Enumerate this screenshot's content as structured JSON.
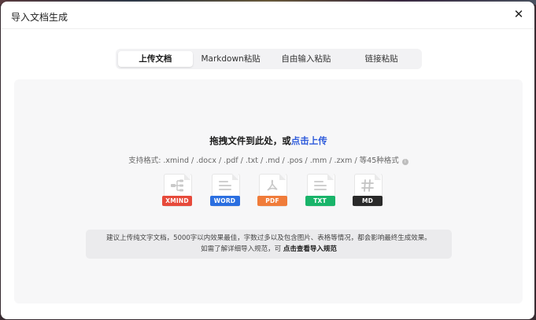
{
  "dialog": {
    "title": "导入文档生成",
    "close_glyph": "✕"
  },
  "tabs": [
    {
      "label": "上传文档",
      "active": true
    },
    {
      "label": "Markdown粘贴",
      "active": false
    },
    {
      "label": "自由输入粘贴",
      "active": false
    },
    {
      "label": "链接粘贴",
      "active": false
    }
  ],
  "upload": {
    "prompt_text": "拖拽文件到此处，或",
    "prompt_link": "点击上传",
    "formats_text": "支持格式: .xmind / .docx / .pdf / .txt / .md / .pos / .mm / .zxm / 等45种格式",
    "info_glyph": "i"
  },
  "file_types": [
    {
      "label": "XMIND",
      "color": "#e74a3b",
      "icon": "mindmap-icon"
    },
    {
      "label": "WORD",
      "color": "#2b6fe0",
      "icon": "document-lines-icon"
    },
    {
      "label": "PDF",
      "color": "#f07c3a",
      "icon": "pdf-icon"
    },
    {
      "label": "TXT",
      "color": "#19b46a",
      "icon": "document-lines-icon"
    },
    {
      "label": "MD",
      "color": "#2a2a2a",
      "icon": "hash-icon"
    }
  ],
  "tip": {
    "line1": "建议上传纯文字文档，5000字以内效果最佳，字数过多以及包含图片、表格等情况，都会影响最终生成效果。",
    "line2_prefix": "如需了解详细导入规范，可",
    "line2_link": "点击查看导入规范"
  }
}
